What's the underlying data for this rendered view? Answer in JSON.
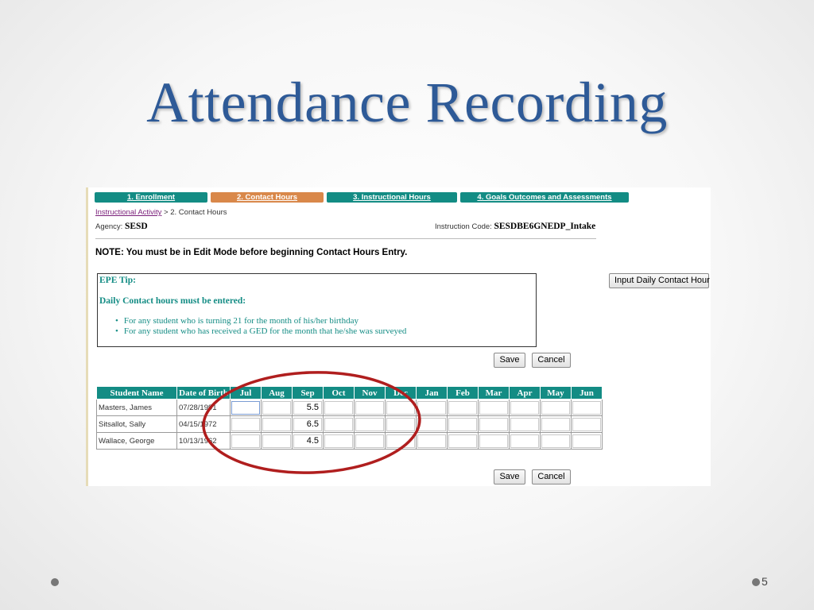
{
  "slide": {
    "title": "Attendance Recording",
    "page_number": "5"
  },
  "tabs": [
    {
      "label": "1. Enrollment",
      "active": false
    },
    {
      "label": "2. Contact Hours",
      "active": true
    },
    {
      "label": "3. Instructional Hours",
      "active": false
    },
    {
      "label": "4. Goals Outcomes and Assessments",
      "active": false
    }
  ],
  "breadcrumb": {
    "link": "Instructional Activity",
    "separator": " > ",
    "current": "2. Contact Hours"
  },
  "agency": {
    "label": "Agency: ",
    "value": "SESD"
  },
  "instruction_code": {
    "label": "Instruction Code: ",
    "value": "SESDBE6GNEDP_Intake"
  },
  "note": "NOTE: You must be in Edit Mode before beginning Contact Hours Entry.",
  "tip": {
    "title": "EPE Tip:",
    "subtitle": "Daily Contact hours must be entered:",
    "items": [
      "For any student who is turning 21 for the month of his/her birthday",
      "For any student who has received a GED for the month that he/she was surveyed"
    ]
  },
  "buttons": {
    "input_daily": "Input Daily Contact Hour",
    "save": "Save",
    "cancel": "Cancel"
  },
  "table": {
    "headers": [
      "Student Name",
      "Date of Birth",
      "Jul",
      "Aug",
      "Sep",
      "Oct",
      "Nov",
      "Dec",
      "Jan",
      "Feb",
      "Mar",
      "Apr",
      "May",
      "Jun"
    ],
    "rows": [
      {
        "name": "Masters, James",
        "dob": "07/28/1991",
        "hours": [
          "",
          "",
          "5.5",
          "",
          "",
          "",
          "",
          "",
          "",
          "",
          "",
          ""
        ]
      },
      {
        "name": "Sitsallot, Sally",
        "dob": "04/15/1972",
        "hours": [
          "",
          "",
          "6.5",
          "",
          "",
          "",
          "",
          "",
          "",
          "",
          "",
          ""
        ]
      },
      {
        "name": "Wallace, George",
        "dob": "10/13/1962",
        "hours": [
          "",
          "",
          "4.5",
          "",
          "",
          "",
          "",
          "",
          "",
          "",
          "",
          ""
        ]
      }
    ]
  },
  "colors": {
    "title": "#2e5a97",
    "tab": "#138c84",
    "tab_active": "#d9884a",
    "annotation": "#b01e1e"
  }
}
